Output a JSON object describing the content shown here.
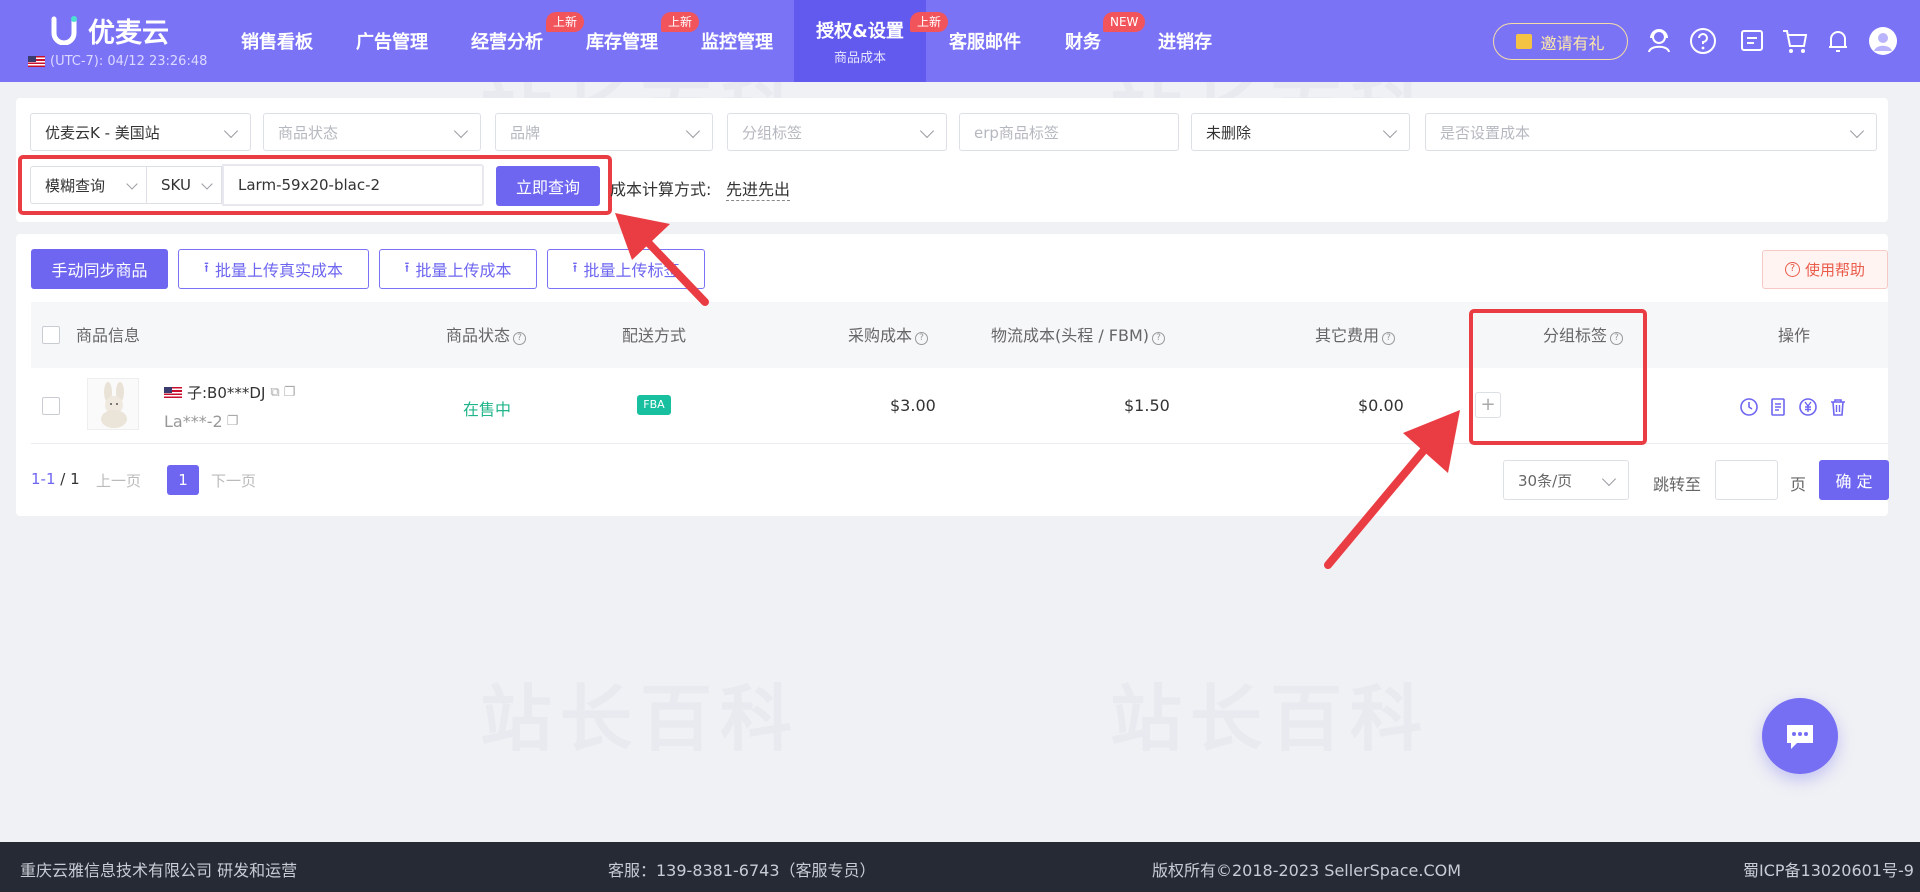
{
  "brand": {
    "logo_text": "优麦云",
    "timezone": "(UTC-7): 04/12 23:26:48"
  },
  "nav": {
    "items": [
      {
        "label": "销售看板"
      },
      {
        "label": "广告管理"
      },
      {
        "label": "经营分析",
        "badge": "上新"
      },
      {
        "label": "库存管理",
        "badge": "上新"
      },
      {
        "label": "监控管理"
      },
      {
        "label": "授权&设置",
        "sub": "商品成本",
        "badge": "上新",
        "active": true
      },
      {
        "label": "客服邮件"
      },
      {
        "label": "财务",
        "badge": "NEW"
      },
      {
        "label": "进销存"
      }
    ],
    "invite_label": "邀请有礼",
    "icons": [
      "headset-icon",
      "help-icon",
      "message-icon",
      "cart-icon",
      "bell-icon",
      "user-avatar-icon"
    ]
  },
  "filters": {
    "store": "优麦云K - 美国站",
    "product_status": "商品状态",
    "brand": "品牌",
    "group_tag": "分组标签",
    "erp_tag": "erp商品标签",
    "deleted": "未删除",
    "cost_set": "是否设置成本",
    "query_mode": "模糊查询",
    "query_field": "SKU",
    "query_value": "Larm-59x20-blac-2",
    "search_button": "立即查询",
    "cost_method_label": "成本计算方式:",
    "cost_method_value": "先进先出"
  },
  "toolbar": {
    "sync_button": "手动同步商品",
    "upload_real_cost": "批量上传真实成本",
    "upload_cost": "批量上传成本",
    "upload_tag": "批量上传标签",
    "help_button": "使用帮助"
  },
  "table": {
    "headers": {
      "product_info": "商品信息",
      "status": "商品状态",
      "shipping": "配送方式",
      "purchase_cost": "采购成本",
      "logistics_cost": "物流成本(头程 / FBM)",
      "other_cost": "其它费用",
      "group_tag": "分组标签",
      "actions": "操作"
    },
    "rows": [
      {
        "child_asin": "子:B0***DJ",
        "sku": "La***-2",
        "status": "在售中",
        "shipping": "FBA",
        "purchase_cost": "$3.00",
        "logistics_cost": "$1.50",
        "other_cost": "$0.00",
        "add_tag": "+"
      }
    ]
  },
  "pagination": {
    "range": "1-1",
    "total": "/ 1",
    "prev": "上一页",
    "current": "1",
    "next": "下一页",
    "page_size": "30条/页",
    "jump_label": "跳转至",
    "page_unit": "页",
    "confirm": "确 定"
  },
  "footer": {
    "company": "重庆云雅信息技术有限公司 研发和运营",
    "service": "客服：139-8381-6743（客服专员）",
    "copyright": "版权所有©2018-2023 SellerSpace.COM",
    "icp": "蜀ICP备13020601号-9"
  },
  "watermark": "站长百科",
  "colors": {
    "primary": "#7b73f6",
    "accent": "#6e66f0",
    "highlight_red": "#ea3d43",
    "status_green": "#20b58a",
    "fba_green": "#19c0a0"
  }
}
